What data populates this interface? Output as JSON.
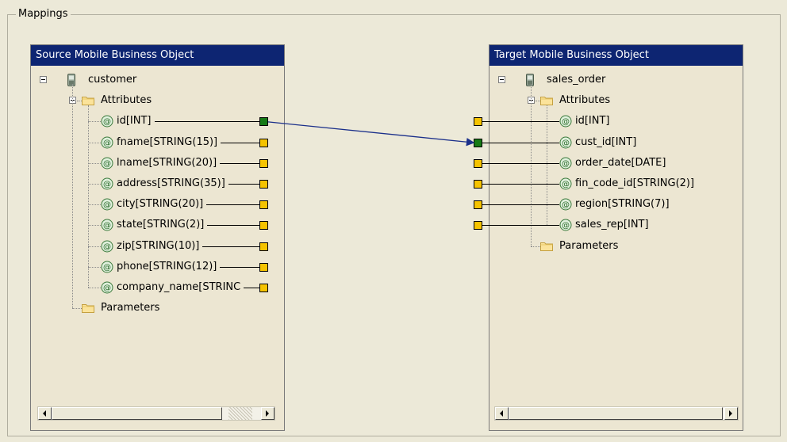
{
  "mappings": {
    "group_title": "Mappings"
  },
  "source": {
    "header": "Source Mobile Business Object",
    "object_name": "customer",
    "attributes_label": "Attributes",
    "parameters_label": "Parameters",
    "attributes": [
      {
        "label": "id[INT]",
        "mapped": true
      },
      {
        "label": "fname[STRING(15)]",
        "mapped": false
      },
      {
        "label": "lname[STRING(20)]",
        "mapped": false
      },
      {
        "label": "address[STRING(35)]",
        "mapped": false
      },
      {
        "label": "city[STRING(20)]",
        "mapped": false
      },
      {
        "label": "state[STRING(2)]",
        "mapped": false
      },
      {
        "label": "zip[STRING(10)]",
        "mapped": false
      },
      {
        "label": "phone[STRING(12)]",
        "mapped": false
      },
      {
        "label": "company_name[STRINC",
        "mapped": false
      }
    ]
  },
  "target": {
    "header": "Target Mobile Business Object",
    "object_name": "sales_order",
    "attributes_label": "Attributes",
    "parameters_label": "Parameters",
    "attributes": [
      {
        "label": "id[INT]",
        "mapped": false
      },
      {
        "label": "cust_id[INT]",
        "mapped": true
      },
      {
        "label": "order_date[DATE]",
        "mapped": false
      },
      {
        "label": "fin_code_id[STRING(2)]",
        "mapped": false
      },
      {
        "label": "region[STRING(7)]",
        "mapped": false
      },
      {
        "label": "sales_rep[INT]",
        "mapped": false
      }
    ]
  },
  "mapping_links": [
    {
      "from": "id[INT]",
      "to": "cust_id[INT]"
    }
  ],
  "colors": {
    "header_bg": "#0d2572",
    "port_unmapped": "#f5c300",
    "port_mapped": "#167a16",
    "link_line": "#1a2f8a",
    "panel_bg": "#ece6d2",
    "window_bg": "#ece9d8"
  },
  "icons": {
    "object": "mobile-device-icon",
    "folder": "folder-icon",
    "attribute": "attribute-icon",
    "expander": "collapse-minus-icon"
  }
}
